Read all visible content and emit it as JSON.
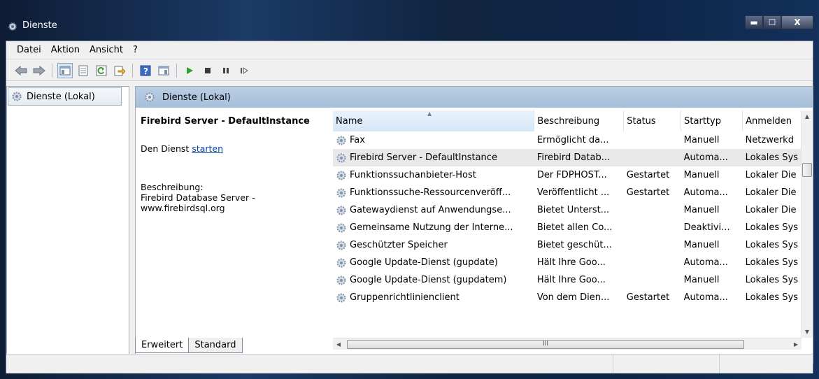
{
  "window": {
    "title": "Dienste",
    "minimize": "▬",
    "maximize": "☐",
    "close": "X"
  },
  "menu": {
    "items": [
      "Datei",
      "Aktion",
      "Ansicht",
      "?"
    ]
  },
  "toolbar": {
    "icons": [
      "back-icon",
      "forward-icon",
      "show-hide-console-tree-icon",
      "properties-icon",
      "refresh-icon",
      "export-list-icon",
      "help-icon",
      "action-pane-icon",
      "play-icon",
      "stop-icon",
      "pause-icon",
      "resume-icon"
    ]
  },
  "tree": {
    "root_label": "Dienste (Lokal)"
  },
  "main": {
    "header_title": "Dienste (Lokal)",
    "selected_service_name": "Firebird Server - DefaultInstance",
    "start_prefix": "Den Dienst ",
    "start_link": "starten",
    "description_label": "Beschreibung:",
    "description_text": "Firebird Database Server - www.firebirdsql.org"
  },
  "table": {
    "columns": [
      "Name",
      "Beschreibung",
      "Status",
      "Starttyp",
      "Anmelden"
    ],
    "rows": [
      {
        "name": "Fax",
        "desc": "Ermöglicht da...",
        "status": "",
        "start": "Manuell",
        "logon": "Netzwerkd"
      },
      {
        "name": "Firebird Server - DefaultInstance",
        "desc": "Firebird Datab...",
        "status": "",
        "start": "Automa...",
        "logon": "Lokales Sys"
      },
      {
        "name": "Funktionssuchanbieter-Host",
        "desc": "Der FDPHOST...",
        "status": "Gestartet",
        "start": "Manuell",
        "logon": "Lokaler Die"
      },
      {
        "name": "Funktionssuche-Ressourcenveröff...",
        "desc": "Veröffentlicht ...",
        "status": "Gestartet",
        "start": "Automa...",
        "logon": "Lokaler Die"
      },
      {
        "name": "Gatewaydienst auf Anwendungse...",
        "desc": "Bietet Unterst...",
        "status": "",
        "start": "Manuell",
        "logon": "Lokaler Die"
      },
      {
        "name": "Gemeinsame Nutzung der Interne...",
        "desc": "Bietet allen Co...",
        "status": "",
        "start": "Deaktivi...",
        "logon": "Lokales Sys"
      },
      {
        "name": "Geschützter Speicher",
        "desc": "Bietet geschüt...",
        "status": "",
        "start": "Manuell",
        "logon": "Lokales Sys"
      },
      {
        "name": "Google Update-Dienst (gupdate)",
        "desc": "Hält Ihre Goo...",
        "status": "",
        "start": "Automa...",
        "logon": "Lokales Sys"
      },
      {
        "name": "Google Update-Dienst (gupdatem)",
        "desc": "Hält Ihre Goo...",
        "status": "",
        "start": "Manuell",
        "logon": "Lokales Sys"
      },
      {
        "name": "Gruppenrichtlinienclient",
        "desc": "Von dem Dien...",
        "status": "Gestartet",
        "start": "Automa...",
        "logon": "Lokales Sys"
      }
    ],
    "selected_index": 1
  },
  "hscroll": {
    "thumb_label": "III"
  },
  "tabs": [
    "Erweitert",
    "Standard"
  ],
  "colors": {
    "accent_header": "#a7bfda",
    "link": "#0645ad"
  }
}
